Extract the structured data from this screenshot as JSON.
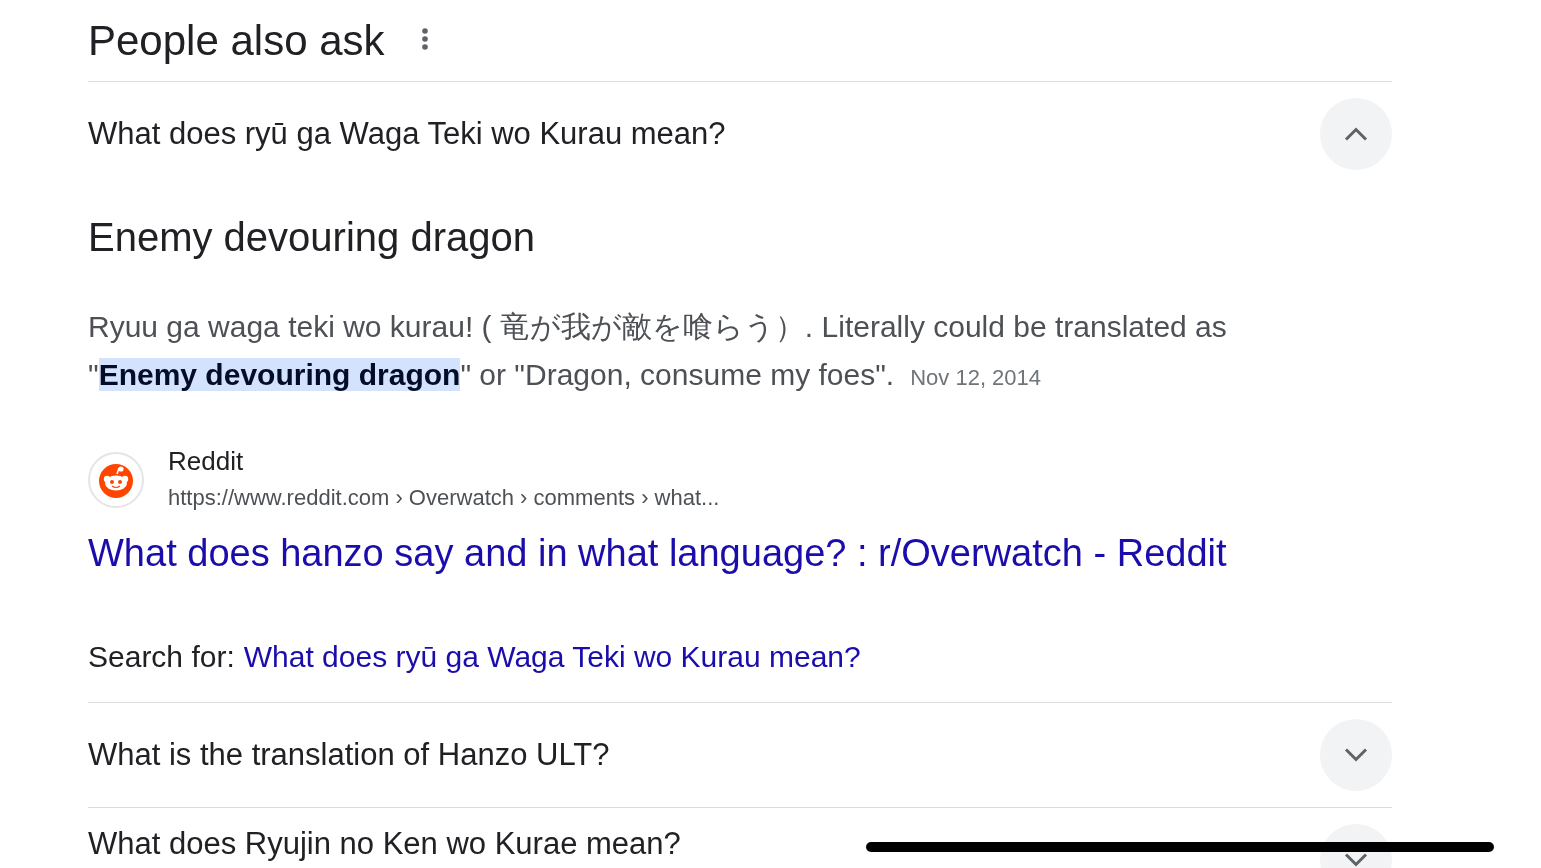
{
  "section": {
    "title": "People also ask"
  },
  "questions": [
    {
      "text": "What does ryū ga Waga Teki wo Kurau mean?",
      "expanded": true,
      "answer": {
        "heading": "Enemy devouring dragon",
        "snippet": "Ryuu ga waga teki wo kurau! ( 竜が我が敵を喰らう）. Literally could be translated as \"**Enemy devouring dragon**\" or \"Dragon, consume my foes\".",
        "date": "Nov 12, 2014",
        "source": {
          "name": "Reddit",
          "url": "https://www.reddit.com › Overwatch › comments › what...",
          "title": "What does hanzo say and in what language? : r/Overwatch - Reddit"
        },
        "search_for": {
          "label": "Search for:",
          "query": "What does ryū ga Waga Teki wo Kurau mean?"
        }
      }
    },
    {
      "text": "What is the translation of Hanzo ULT?",
      "expanded": false
    },
    {
      "text": "What does Ryujin no Ken wo Kurae mean?",
      "expanded": false
    }
  ]
}
